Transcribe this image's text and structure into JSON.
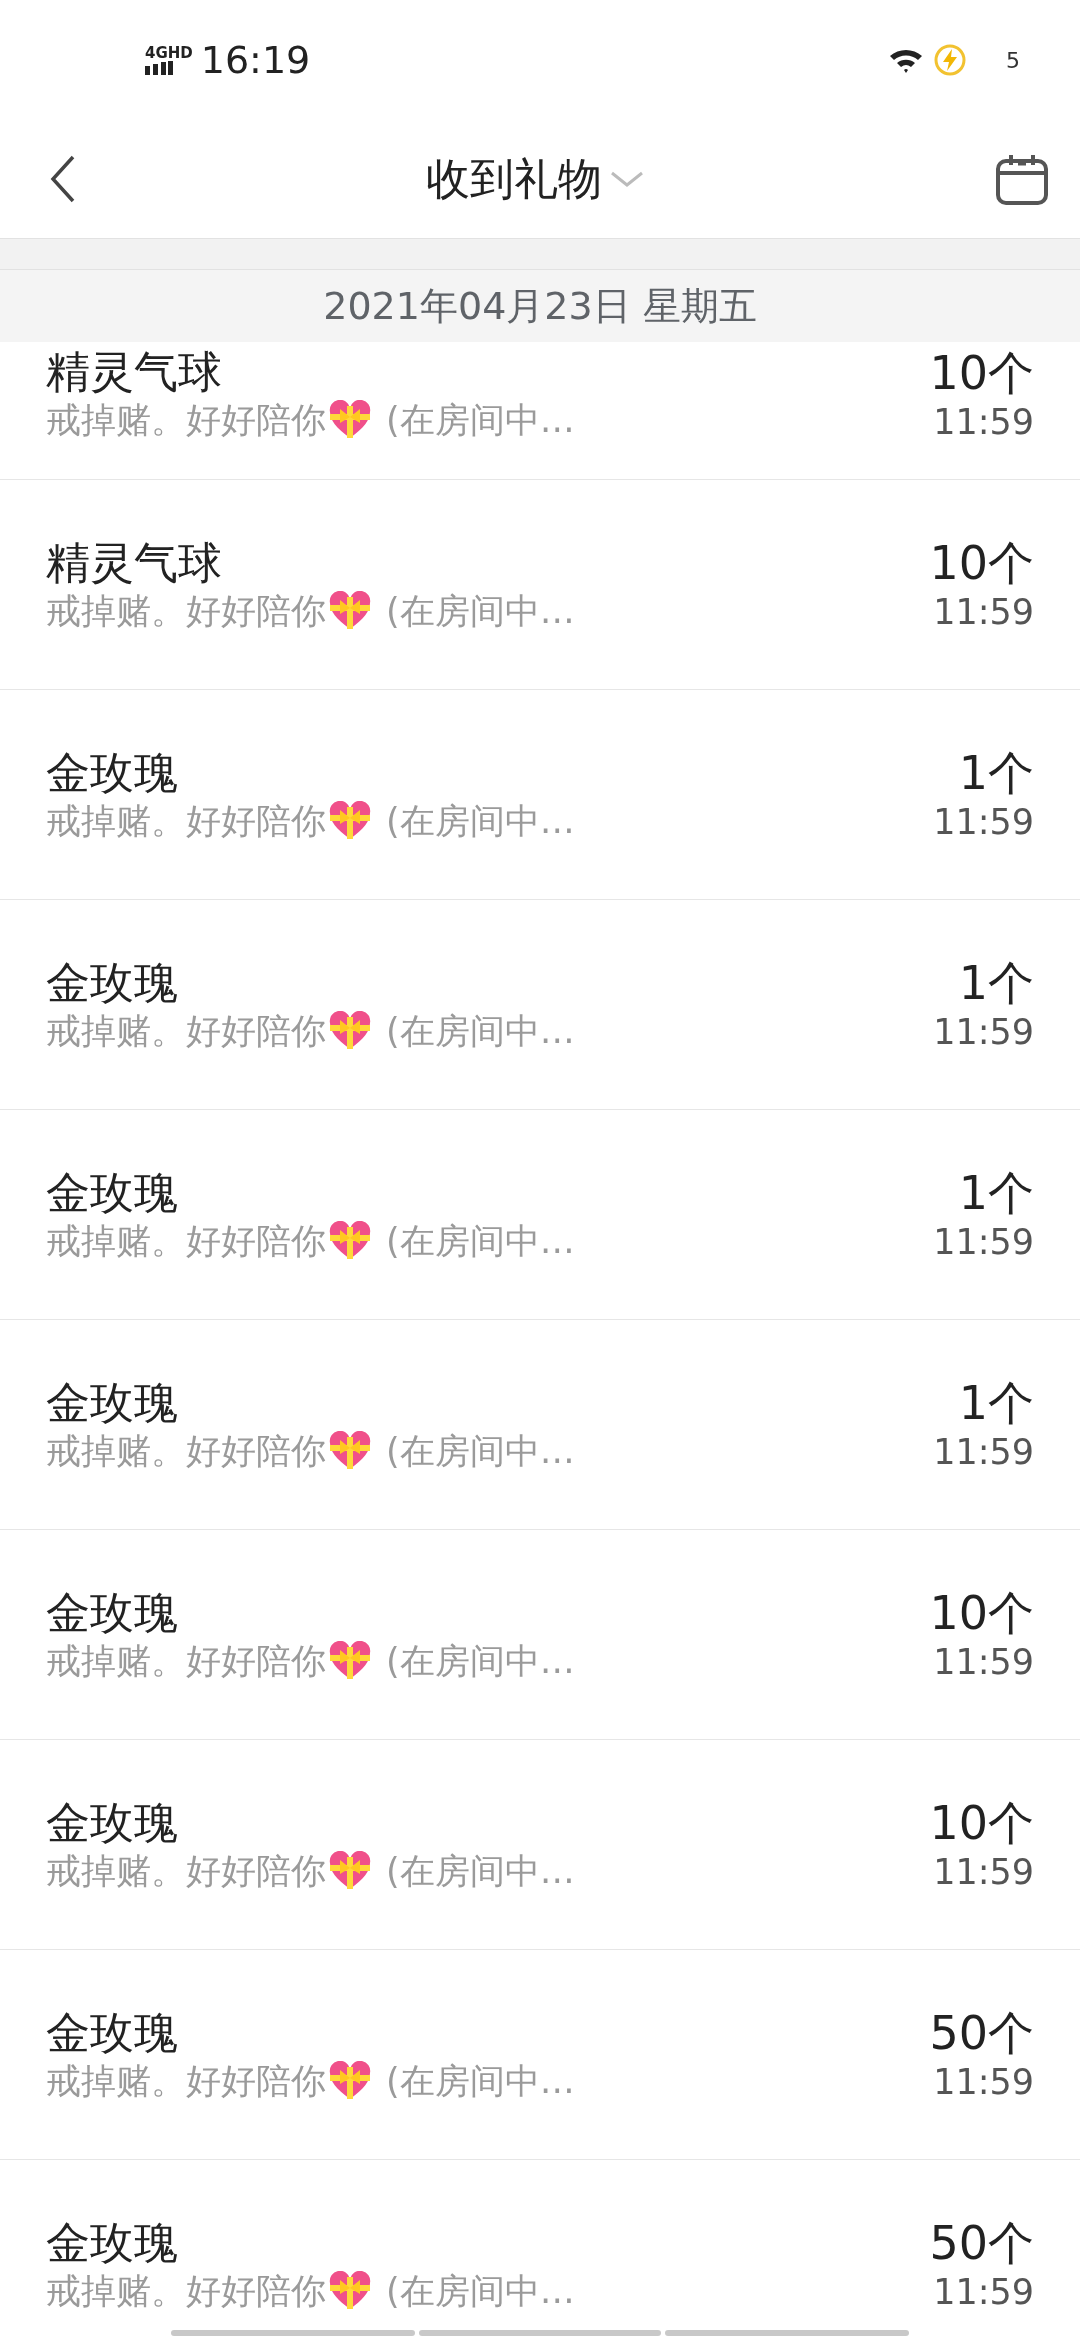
{
  "status_bar": {
    "network": "4G",
    "hd": "HD",
    "time": "16:19",
    "battery": "5"
  },
  "header": {
    "title": "收到礼物"
  },
  "date_header": "2021年04月23日 星期五",
  "gifts": [
    {
      "name": "精灵气球",
      "message_before": "戒掉赌。好好陪你",
      "message_after": "(在房间中…",
      "quantity": "10个",
      "time": "11:59"
    },
    {
      "name": "精灵气球",
      "message_before": "戒掉赌。好好陪你",
      "message_after": "(在房间中…",
      "quantity": "10个",
      "time": "11:59"
    },
    {
      "name": "金玫瑰",
      "message_before": "戒掉赌。好好陪你",
      "message_after": "(在房间中…",
      "quantity": "1个",
      "time": "11:59"
    },
    {
      "name": "金玫瑰",
      "message_before": "戒掉赌。好好陪你",
      "message_after": "(在房间中…",
      "quantity": "1个",
      "time": "11:59"
    },
    {
      "name": "金玫瑰",
      "message_before": "戒掉赌。好好陪你",
      "message_after": "(在房间中…",
      "quantity": "1个",
      "time": "11:59"
    },
    {
      "name": "金玫瑰",
      "message_before": "戒掉赌。好好陪你",
      "message_after": "(在房间中…",
      "quantity": "1个",
      "time": "11:59"
    },
    {
      "name": "金玫瑰",
      "message_before": "戒掉赌。好好陪你",
      "message_after": "(在房间中…",
      "quantity": "10个",
      "time": "11:59"
    },
    {
      "name": "金玫瑰",
      "message_before": "戒掉赌。好好陪你",
      "message_after": "(在房间中…",
      "quantity": "10个",
      "time": "11:59"
    },
    {
      "name": "金玫瑰",
      "message_before": "戒掉赌。好好陪你",
      "message_after": "(在房间中…",
      "quantity": "50个",
      "time": "11:59"
    },
    {
      "name": "金玫瑰",
      "message_before": "戒掉赌。好好陪你",
      "message_after": "(在房间中…",
      "quantity": "50个",
      "time": "11:59"
    }
  ]
}
